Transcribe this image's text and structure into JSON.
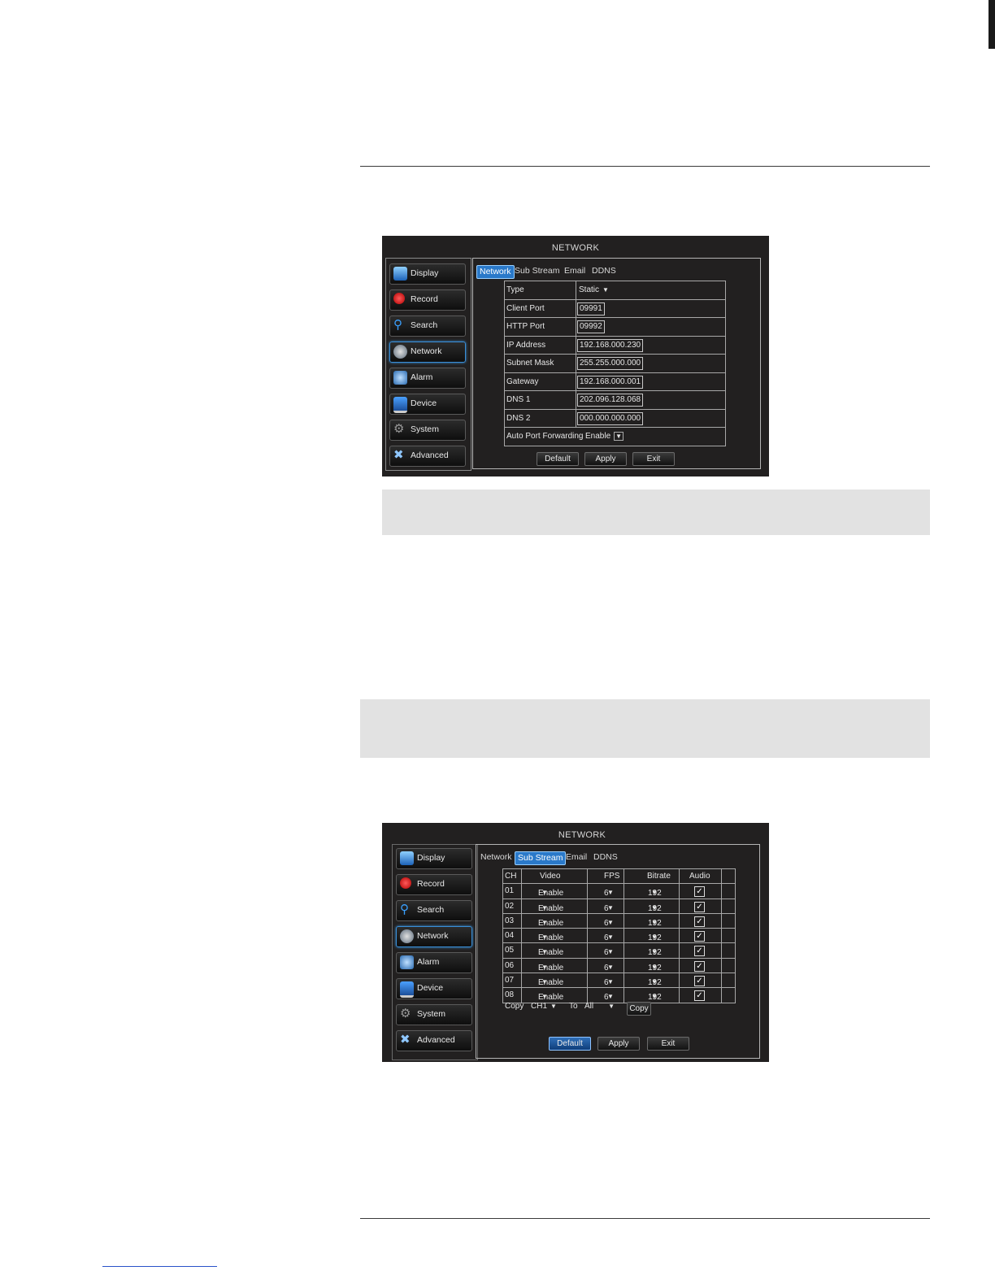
{
  "screen1": {
    "title": "NETWORK",
    "menu": [
      "Display",
      "Record",
      "Search",
      "Network",
      "Alarm",
      "Device",
      "System",
      "Advanced"
    ],
    "tabs": [
      "Network",
      "Sub Stream",
      "Email",
      "DDNS"
    ],
    "selected_tab": "Network",
    "fields": {
      "type_label": "Type",
      "type_value": "Static",
      "client_port_label": "Client Port",
      "client_port_value": "09991",
      "http_port_label": "HTTP Port",
      "http_port_value": "09992",
      "ip_label": "IP Address",
      "ip_value": "192.168.000.230",
      "subnet_label": "Subnet Mask",
      "subnet_value": "255.255.000.000",
      "gateway_label": "Gateway",
      "gateway_value": "192.168.000.001",
      "dns1_label": "DNS 1",
      "dns1_value": "202.096.128.068",
      "dns2_label": "DNS 2",
      "dns2_value": "000.000.000.000",
      "apf_label": "Auto Port Forwarding",
      "apf_value": "Enable"
    },
    "buttons": {
      "default": "Default",
      "apply": "Apply",
      "exit": "Exit"
    }
  },
  "screen2": {
    "title": "NETWORK",
    "menu": [
      "Display",
      "Record",
      "Search",
      "Network",
      "Alarm",
      "Device",
      "System",
      "Advanced"
    ],
    "tabs": [
      "Network",
      "Sub Stream",
      "Email",
      "DDNS"
    ],
    "selected_tab": "Sub Stream",
    "headers": {
      "ch": "CH",
      "video": "Video",
      "fps": "FPS",
      "bitrate": "Bitrate",
      "audio": "Audio"
    },
    "rows": [
      {
        "ch": "01",
        "video": "Enable",
        "fps": "6",
        "bitrate": "192",
        "audio": true
      },
      {
        "ch": "02",
        "video": "Enable",
        "fps": "6",
        "bitrate": "192",
        "audio": true
      },
      {
        "ch": "03",
        "video": "Enable",
        "fps": "6",
        "bitrate": "192",
        "audio": true
      },
      {
        "ch": "04",
        "video": "Enable",
        "fps": "6",
        "bitrate": "192",
        "audio": true
      },
      {
        "ch": "05",
        "video": "Enable",
        "fps": "6",
        "bitrate": "192",
        "audio": true
      },
      {
        "ch": "06",
        "video": "Enable",
        "fps": "6",
        "bitrate": "192",
        "audio": true
      },
      {
        "ch": "07",
        "video": "Enable",
        "fps": "6",
        "bitrate": "192",
        "audio": true
      },
      {
        "ch": "08",
        "video": "Enable",
        "fps": "6",
        "bitrate": "192",
        "audio": true
      }
    ],
    "copy": {
      "label": "Copy",
      "from": "CH1",
      "to_label": "To",
      "to": "All",
      "button": "Copy"
    },
    "buttons": {
      "default": "Default",
      "apply": "Apply",
      "exit": "Exit"
    }
  },
  "icons": {
    "Display": "monitor-icon",
    "Record": "record-icon",
    "Search": "magnifier-icon",
    "Network": "globe-icon",
    "Alarm": "alarm-icon",
    "Device": "device-icon",
    "System": "gears-icon",
    "Advanced": "tools-icon"
  },
  "colors": {
    "accent_blue": "#2a79c9",
    "screen_bg": "#222020",
    "note_grey": "#e2e2e2"
  }
}
